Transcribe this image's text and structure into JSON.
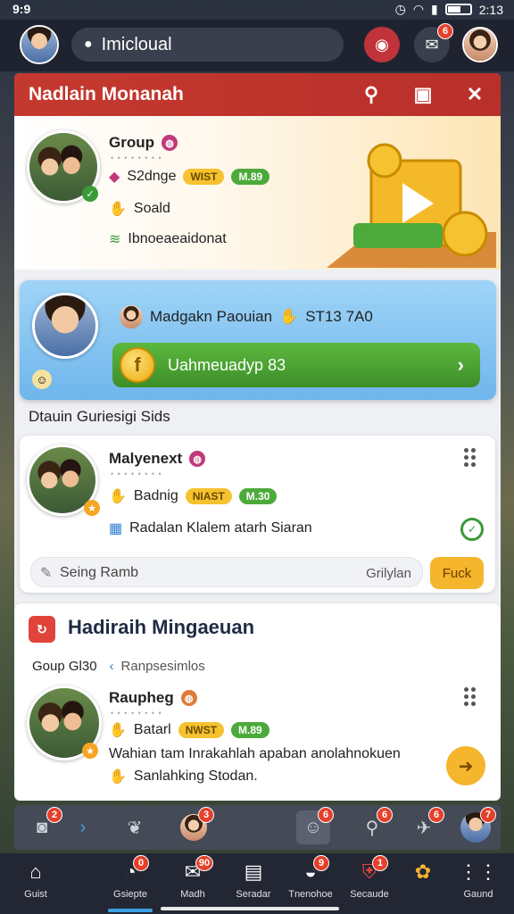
{
  "status": {
    "time": "9:9",
    "clock_right": "2:13"
  },
  "topbar": {
    "search_text": "Imicloual",
    "badges": [
      "",
      "6",
      ""
    ]
  },
  "panel": {
    "title": "Nadlain Monanah",
    "header_colors": {
      "accent": "#c4392f"
    }
  },
  "hero": {
    "group_label": "Group",
    "row1": "S2dnge",
    "row1_pill_gold": "WIST",
    "row1_pill_green": "M.89",
    "row2": "Soald",
    "row3": "Ibnoeaeaidonat"
  },
  "promo": {
    "title": "Madgakn Paouian",
    "amount": "ST13 7A0",
    "button_label": "Uahmeuadyp 83",
    "coin_symbol": "f"
  },
  "section": {
    "label": "Dtauin Guriesigi Sids"
  },
  "card1": {
    "name": "Malyenext",
    "row1": "Badnig",
    "pill_gold": "NIAST",
    "pill_green": "M.30",
    "row2": "Radalan Klalem atarh Siaran",
    "input_text": "Seing Ramb",
    "input_right": "Grilylan",
    "action_label": "Fuck"
  },
  "card2": {
    "title": "Hadiraih Mingaeuan",
    "group_text": "Goup Gl30",
    "link_text": "Ranpsesimlos",
    "name": "Raupheg",
    "row1": "Batarl",
    "pill_gold": "NWST",
    "pill_green": "M.89",
    "row2": "Wahian tam Inrakahlah apaban anolahnokuen",
    "row3": "Sanlahking Stodan."
  },
  "dock": {
    "badges": [
      "2",
      "3",
      "6",
      "6",
      "6",
      "7"
    ]
  },
  "bottomnav": {
    "items": [
      {
        "label": "Guist",
        "badge": ""
      },
      {
        "label": "Gsiepte",
        "badge": "0"
      },
      {
        "label": "Madh",
        "badge": "90"
      },
      {
        "label": "Seradar",
        "badge": ""
      },
      {
        "label": "Tnenohoe",
        "badge": "9"
      },
      {
        "label": "Secaude",
        "badge": "1"
      },
      {
        "label": "",
        "badge": ""
      },
      {
        "label": "Gaund",
        "badge": ""
      }
    ]
  }
}
